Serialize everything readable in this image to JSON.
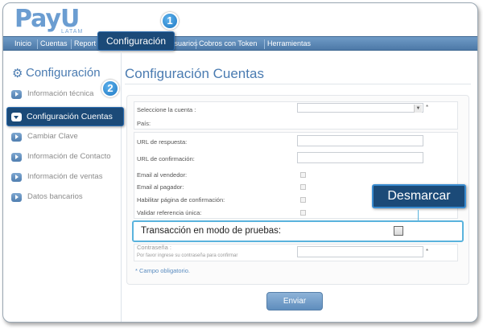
{
  "logo": {
    "word": "PayU",
    "sub": "LATAM"
  },
  "nav": {
    "items": [
      "Inicio",
      "Cuentas",
      "Report",
      "Usuarios",
      "Cobros con Token",
      "Herramientas"
    ],
    "active": "Configuración"
  },
  "badges": {
    "step1": "1",
    "step2": "2"
  },
  "sidebar": {
    "title": "Configuración",
    "items": [
      {
        "label": "Información técnica"
      },
      {
        "label": "Configuración Cuentas",
        "active": true
      },
      {
        "label": "Cambiar Clave"
      },
      {
        "label": "Información de Contacto"
      },
      {
        "label": "Información de ventas"
      },
      {
        "label": "Datos bancarios"
      }
    ]
  },
  "main": {
    "title": "Configuración Cuentas",
    "form": {
      "account_label": "Seleccione la cuenta :",
      "country_label": "País:",
      "response_url_label": "URL de respuesta:",
      "confirm_url_label": "URL de confirmación:",
      "email_seller_label": "Email al vendedor:",
      "email_payer_label": "Email al pagador:",
      "enable_confirm_label": "Habilitar página de confirmación:",
      "validate_ref_label": "Validar referencia única:",
      "test_mode_label": "Transacción en modo de pruebas:",
      "password_label": "Contraseña :",
      "password_hint": "Por favor ingrese su contraseña para confirmar",
      "required_mark": "*",
      "required_note": "* Campo obligatorio."
    },
    "callout": "Desmarcar",
    "submit_label": "Enviar"
  },
  "colors": {
    "accent": "#4a7bb1",
    "highlight": "#1b4a78",
    "callout_border": "#5ab3dd"
  }
}
